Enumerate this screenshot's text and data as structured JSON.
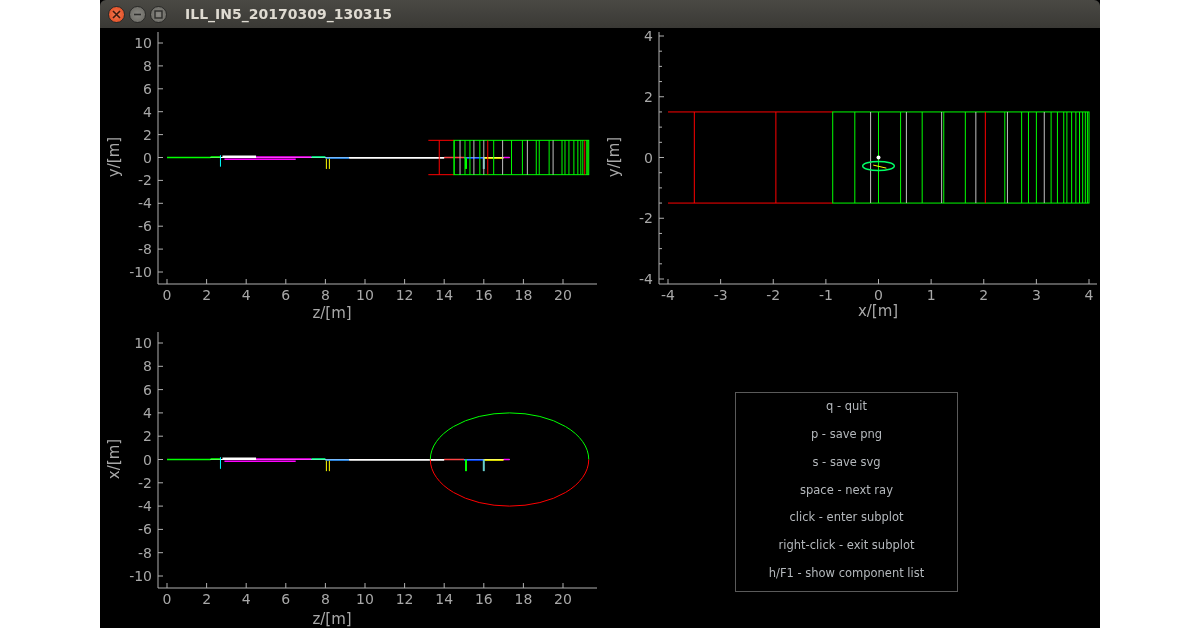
{
  "window": {
    "title": "ILL_IN5_20170309_130315"
  },
  "plots": [
    {
      "kind": "side-view",
      "xlabel": "z/[m]",
      "ylabel": "y/[m]",
      "xticks": [
        "0",
        "2",
        "4",
        "6",
        "8",
        "10",
        "12",
        "14",
        "16",
        "18",
        "20"
      ],
      "yticks": [
        "10",
        "8",
        "6",
        "4",
        "2",
        "0",
        "-2",
        "-4",
        "-6",
        "-8",
        "-10"
      ]
    },
    {
      "kind": "end-view",
      "xlabel": "x/[m]",
      "ylabel": "y/[m]",
      "xticks": [
        "-4",
        "-3",
        "-2",
        "-1",
        "0",
        "1",
        "2",
        "3",
        "4"
      ],
      "yticks": [
        "4",
        "2",
        "0",
        "-2",
        "-4"
      ]
    },
    {
      "kind": "top-view",
      "xlabel": "z/[m]",
      "ylabel": "x/[m]",
      "xticks": [
        "0",
        "2",
        "4",
        "6",
        "8",
        "10",
        "12",
        "14",
        "16",
        "18",
        "20"
      ],
      "yticks": [
        "10",
        "8",
        "6",
        "4",
        "2",
        "0",
        "-2",
        "-4",
        "-6",
        "-8",
        "-10"
      ]
    }
  ],
  "help": [
    "q - quit",
    "p - save png",
    "s - save svg",
    "space - next ray",
    "click - enter subplot",
    "right-click - exit subplot",
    "h/F1 - show component list"
  ]
}
